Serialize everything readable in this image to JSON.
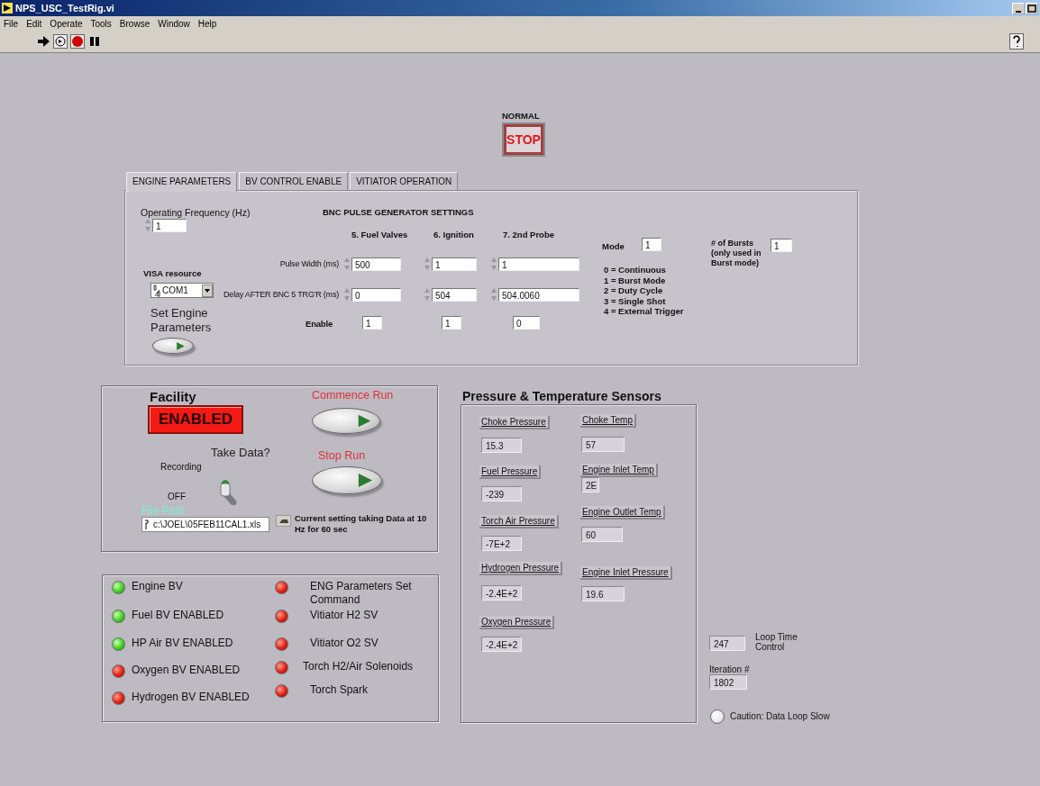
{
  "window": {
    "title": "NPS_USC_TestRig.vi"
  },
  "menu": [
    "File",
    "Edit",
    "Operate",
    "Tools",
    "Browse",
    "Window",
    "Help"
  ],
  "stop_control": {
    "label": "NORMAL",
    "button": "STOP"
  },
  "tabs": [
    {
      "label": "ENGINE PARAMETERS",
      "selected": true
    },
    {
      "label": "BV CONTROL ENABLE",
      "selected": false
    },
    {
      "label": "VITIATOR OPERATION",
      "selected": false
    }
  ],
  "engine_parameters": {
    "operating_frequency": {
      "label": "Operating Frequency (Hz)",
      "value": "1"
    },
    "visa_resource": {
      "label": "VISA resource",
      "value": "COM1"
    },
    "set_engine_parameters": {
      "label": "Set Engine Parameters",
      "on": false
    },
    "bnc_title": "BNC PULSE GENERATOR SETTINGS",
    "columns": [
      "5. Fuel Valves",
      "6. Ignition",
      "7. 2nd Probe"
    ],
    "rows": [
      {
        "label": "Pulse Width (ms)",
        "kind": "numeric",
        "values": [
          "500",
          "1",
          "1"
        ]
      },
      {
        "label": "Delay AFTER BNC  5 TRG'R (ms)",
        "kind": "numeric",
        "values": [
          "0",
          "504",
          "504.0060"
        ]
      },
      {
        "label": "Enable",
        "kind": "plain",
        "values": [
          "1",
          "1",
          "0"
        ]
      }
    ],
    "mode": {
      "label": "Mode",
      "value": "1"
    },
    "mode_legend": [
      "0 = Continuous",
      "1 = Burst Mode",
      "2 = Duty Cycle",
      "3 = Single Shot",
      "4 = External Trigger"
    ],
    "bursts": {
      "label": "# of Bursts (only used in Burst mode)",
      "value": "1"
    }
  },
  "facility": {
    "label": "Facility",
    "status": "ENABLED",
    "commence_run": "Commence Run",
    "stop_run": "Stop Run",
    "take_data": {
      "label": "Take Data?",
      "on_label": "Recording",
      "off_label": "OFF",
      "on": false
    },
    "file_path": {
      "label": "File Path",
      "value": "c:\\JOEL\\05FEB11CAL1.xls"
    },
    "note": "Current setting taking Data at 10 Hz for 60 sec"
  },
  "sensors": {
    "title": "Pressure & Temperature  Sensors",
    "left": [
      {
        "label": "Choke Pressure",
        "value": "15.3"
      },
      {
        "label": "Fuel Pressure",
        "value": "-239"
      },
      {
        "label": "Torch Air Pressure",
        "value": "-7E+2"
      },
      {
        "label": "Hydrogen Pressure",
        "value": "-2.4E+2"
      },
      {
        "label": "Oxygen Pressure",
        "value": "-2.4E+2"
      }
    ],
    "right": [
      {
        "label": "Choke Temp",
        "value": "57"
      },
      {
        "label": "Engine Inlet Temp",
        "value": "2E"
      },
      {
        "label": "Engine Outlet Temp",
        "value": "60"
      },
      {
        "label": "Engine Inlet Pressure",
        "value": "19.6"
      }
    ]
  },
  "leds_left": [
    {
      "label": "Engine BV",
      "on": true
    },
    {
      "label": "Fuel BV ENABLED",
      "on": true
    },
    {
      "label": "HP Air BV ENABLED",
      "on": true
    },
    {
      "label": "Oxygen BV ENABLED",
      "on": false
    },
    {
      "label": "Hydrogen BV ENABLED",
      "on": false
    }
  ],
  "leds_right": [
    {
      "label": "ENG Parameters Set Command",
      "on": false
    },
    {
      "label": "Vitiator H2 SV",
      "on": false
    },
    {
      "label": "Vitiator O2 SV",
      "on": false
    },
    {
      "label": "Torch H2/Air Solenoids",
      "on": false
    },
    {
      "label": "Torch Spark",
      "on": false
    }
  ],
  "loop": {
    "loop_time": {
      "label": "Loop Time Control",
      "value": "247"
    },
    "iteration": {
      "label": "Iteration #",
      "value": "1802"
    },
    "caution": {
      "label": "Caution: Data Loop Slow",
      "on": false
    }
  }
}
